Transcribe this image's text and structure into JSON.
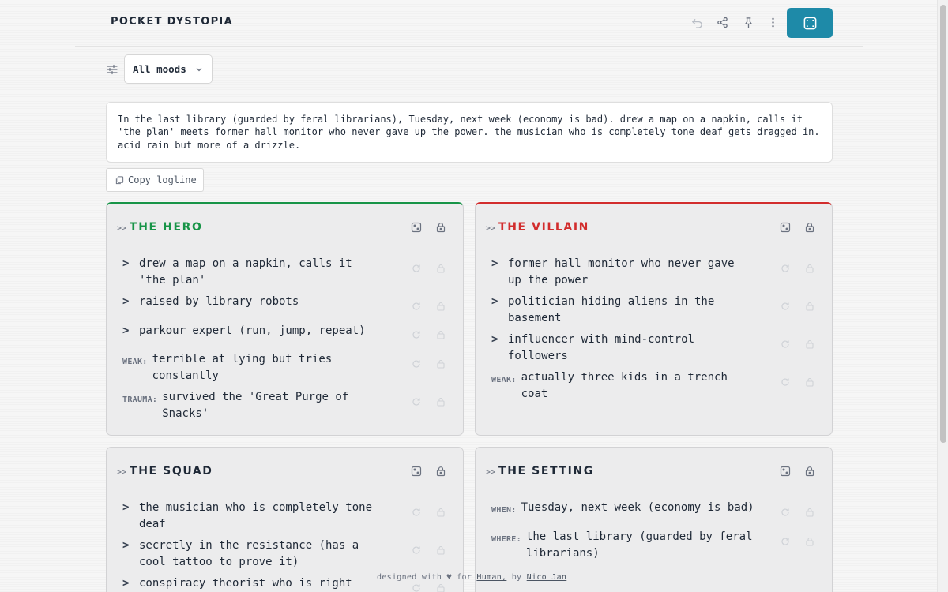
{
  "header": {
    "brand": "POCKET DYSTOPIA",
    "icons": [
      "undo-icon",
      "share-icon",
      "pin-icon",
      "more-icon",
      "fullscreen-icon"
    ]
  },
  "filter": {
    "selected": "All moods"
  },
  "logline": {
    "text": "In the last library (guarded by feral librarians), Tuesday, next week (economy is bad). drew a map on a napkin, calls it 'the plan' meets former hall monitor who never gave up the power. the musician who is completely tone deaf gets dragged in. acid rain but more of a drizzle.",
    "copy_label": "Copy logline"
  },
  "cards": {
    "hero": {
      "prompt": ">>",
      "title": "THE HERO",
      "accent": "#179447",
      "items": [
        "drew a map on a napkin, calls it 'the plan'",
        "raised by library robots",
        "parkour expert (run, jump, repeat)"
      ],
      "weak_tag": "WEAK:",
      "weak": "terrible at lying but tries constantly",
      "trauma_tag": "TRAUMA:",
      "trauma": "survived the 'Great Purge of Snacks'"
    },
    "villain": {
      "prompt": ">>",
      "title": "THE VILLAIN",
      "accent": "#d22d2d",
      "items": [
        "former hall monitor who never gave up the power",
        "politician hiding aliens in the basement",
        "influencer with mind-control followers"
      ],
      "weak_tag": "WEAK:",
      "weak": "actually three kids in a trench coat"
    },
    "squad": {
      "prompt": ">>",
      "title": "THE SQUAD",
      "items": [
        "the musician who is completely tone deaf",
        "secretly in the resistance (has a cool tattoo to prove it)",
        "conspiracy theorist who is right"
      ]
    },
    "setting": {
      "prompt": ">>",
      "title": "THE SETTING",
      "when_tag": "WHEN:",
      "when": "Tuesday, next week (economy is bad)",
      "where_tag": "WHERE:",
      "where": "the last library (guarded by feral librarians)"
    }
  },
  "footer": {
    "prefix": "designed with ♥ for",
    "link1": "Human,",
    "middle": "by",
    "link2": "Nico Jan"
  },
  "colors": {
    "accent": "#1e8aa8",
    "hero": "#179447",
    "villain": "#d22d2d"
  }
}
